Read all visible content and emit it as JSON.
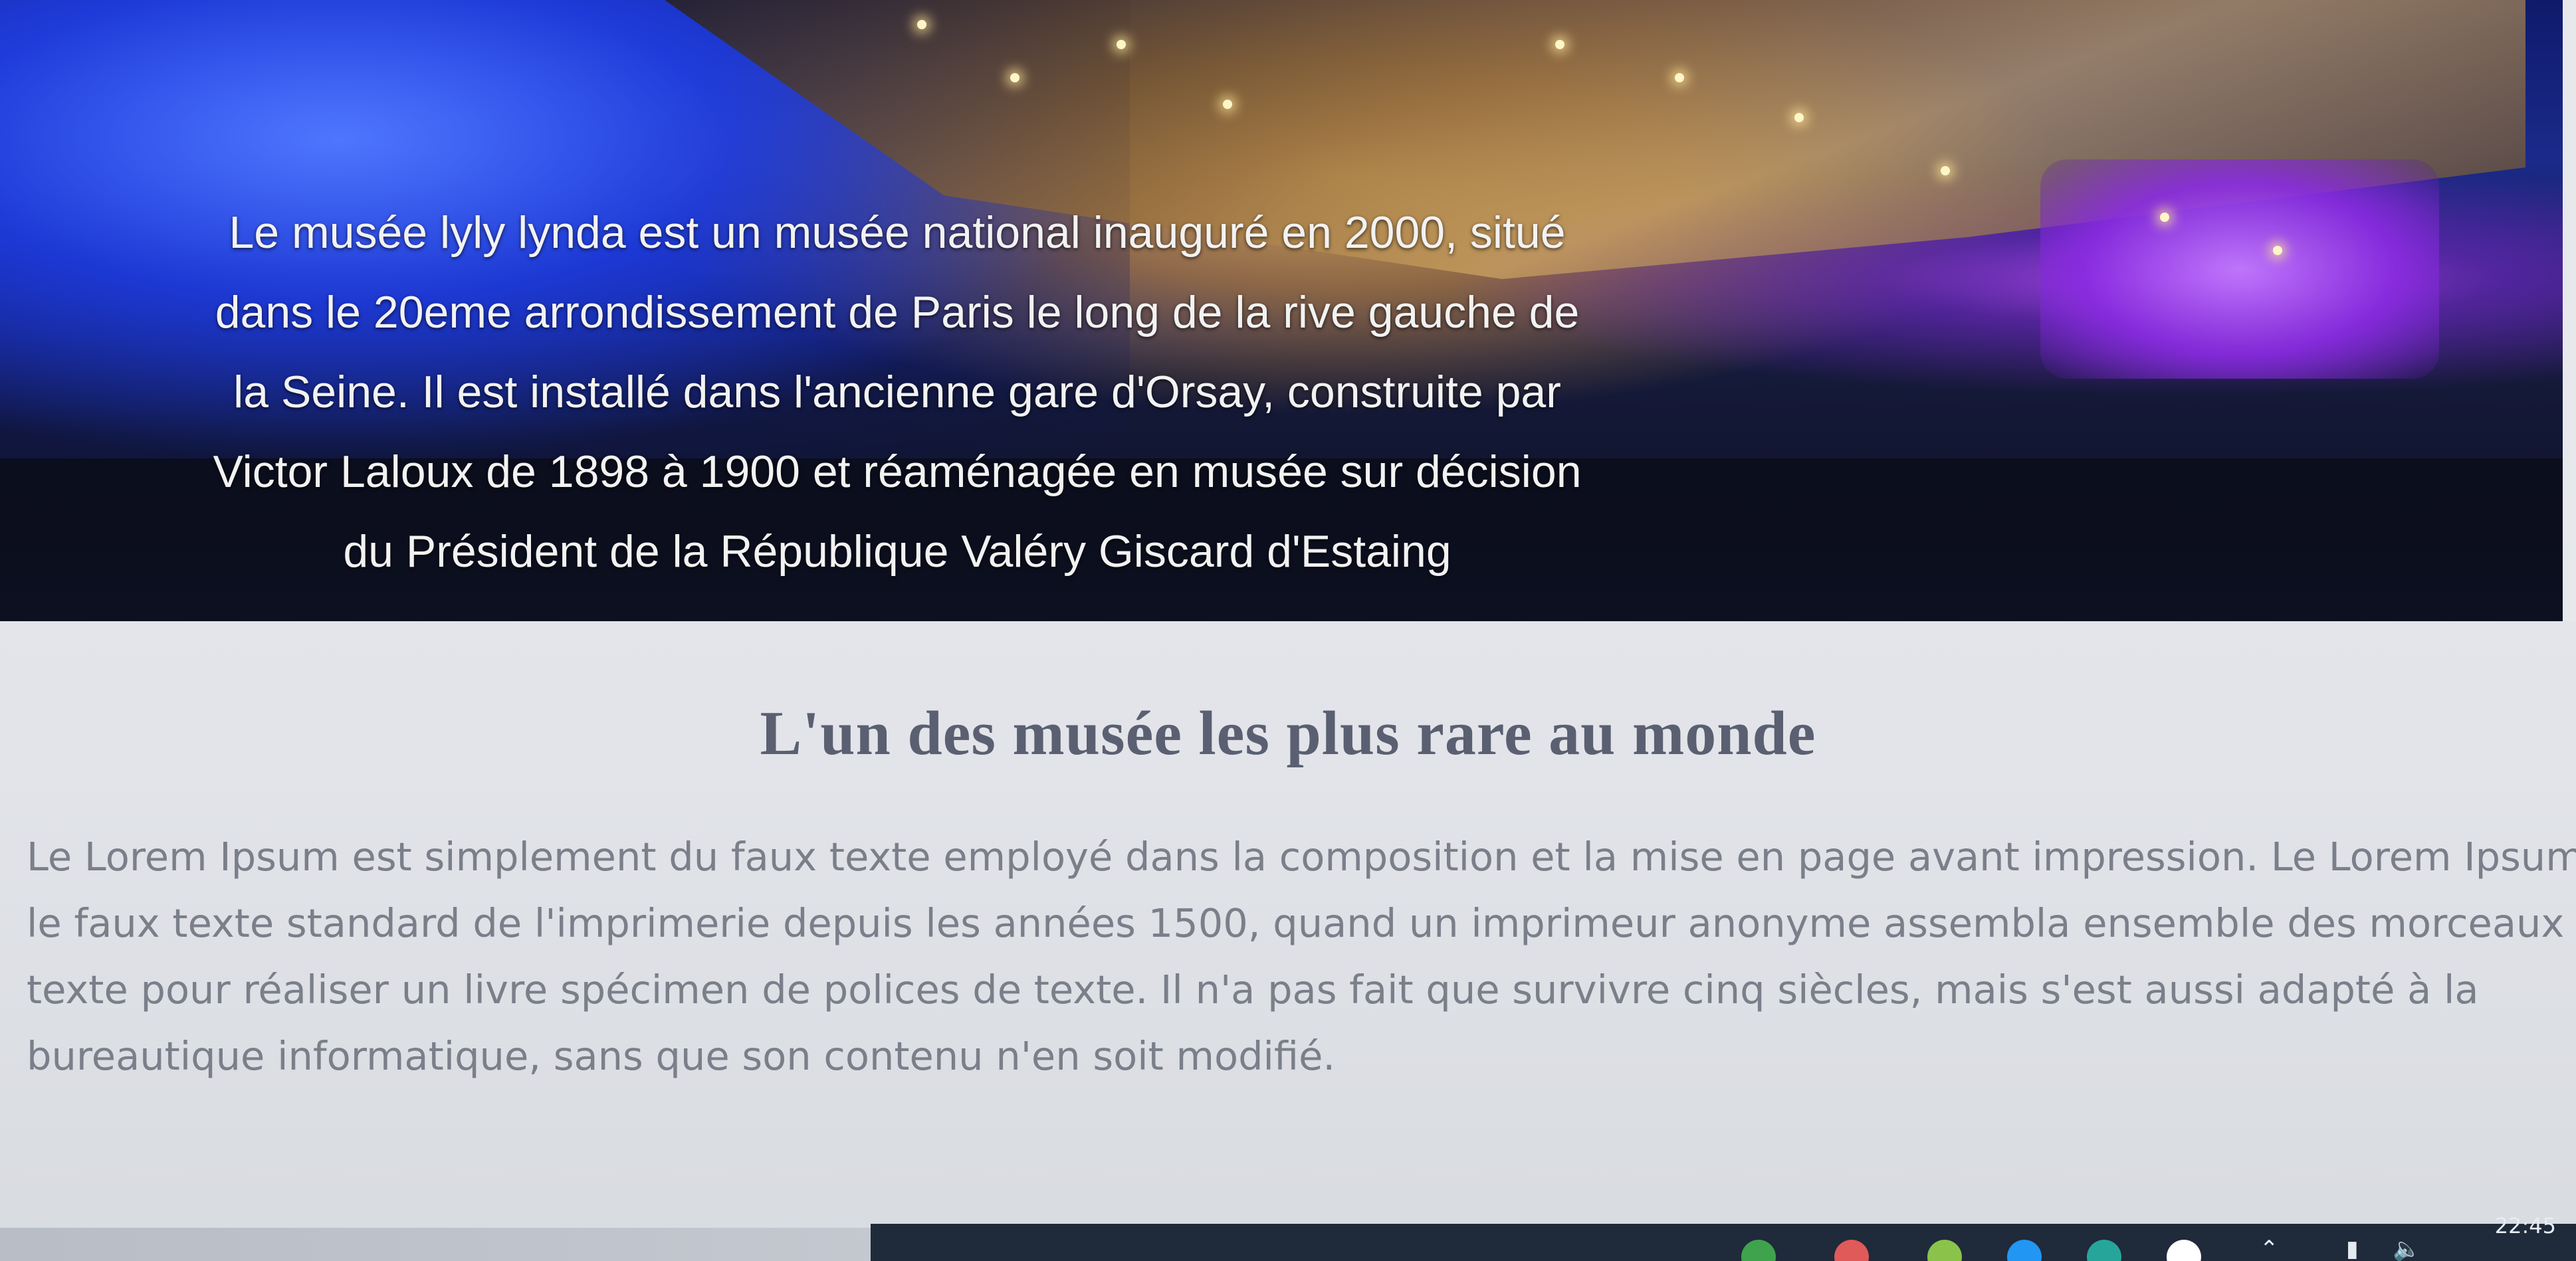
{
  "hero": {
    "caption_lines": [
      "Le musée lyly lynda est un musée national inauguré en 2000, situé",
      "dans le 20eme arrondissement de Paris le long de la rive gauche de",
      "la Seine. Il est installé dans l'ancienne gare d'Orsay, construite par",
      "Victor Laloux de 1898 à 1900 et réaménagée en musée sur décision",
      "du Président de la République Valéry Giscard d'Estaing"
    ]
  },
  "section": {
    "title": "L'un des musée les plus rare au monde",
    "body_lines": [
      "Le Lorem Ipsum est simplement du faux texte employé dans la composition et la mise en page avant impression. Le Lorem Ipsum es",
      "le faux texte standard de l'imprimerie depuis les années 1500, quand un imprimeur anonyme assembla ensemble des morceaux de",
      "texte pour réaliser un livre spécimen de polices de texte. Il n'a pas fait que survivre cinq siècles, mais s'est aussi adapté à la",
      "bureautique informatique, sans que son contenu n'en soit modifié."
    ]
  },
  "taskbar": {
    "clock": "22:45",
    "icons": [
      {
        "name": "app-icon-1",
        "color": "#4caf50"
      },
      {
        "name": "app-icon-2",
        "color": "#ff9800"
      },
      {
        "name": "app-icon-3",
        "color": "#8bc34a"
      },
      {
        "name": "app-icon-4",
        "color": "#2196f3"
      },
      {
        "name": "app-icon-5",
        "color": "#9c27b0"
      },
      {
        "name": "app-icon-6",
        "color": "#ffeb3b"
      }
    ],
    "tray_icons": [
      "up-arrow-icon",
      "battery-icon",
      "volume-icon"
    ]
  }
}
